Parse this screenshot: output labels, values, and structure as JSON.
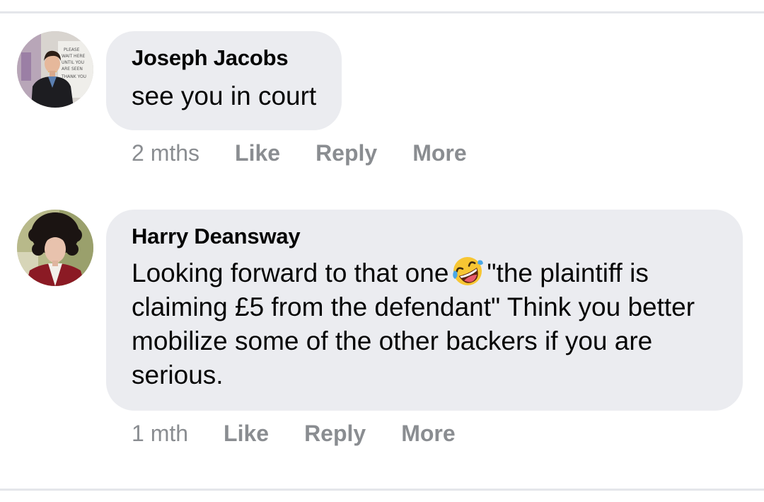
{
  "comments": [
    {
      "author": "Joseph Jacobs",
      "text": "see you in court",
      "time": "2 mths",
      "actions": {
        "like": "Like",
        "reply": "Reply",
        "more": "More"
      },
      "avatar_sign_text": [
        "PLEASE",
        "WAIT HERE",
        "UNTIL YOU",
        "ARE SEEN",
        "THANK YOU"
      ]
    },
    {
      "author": "Harry Deansway",
      "text_before_emoji": "Looking forward to that one",
      "emoji": "rolling-on-the-floor-laughing",
      "text_after_emoji": "\"the plaintiff is claiming £5 from the defendant\" Think you better mobilize some of the other backers if you are serious.",
      "time": "1 mth",
      "actions": {
        "like": "Like",
        "reply": "Reply",
        "more": "More"
      }
    }
  ],
  "colors": {
    "bubble": "#ebecf0",
    "text": "#050505",
    "meta": "#8a8d91",
    "divider": "#e4e6ea"
  }
}
